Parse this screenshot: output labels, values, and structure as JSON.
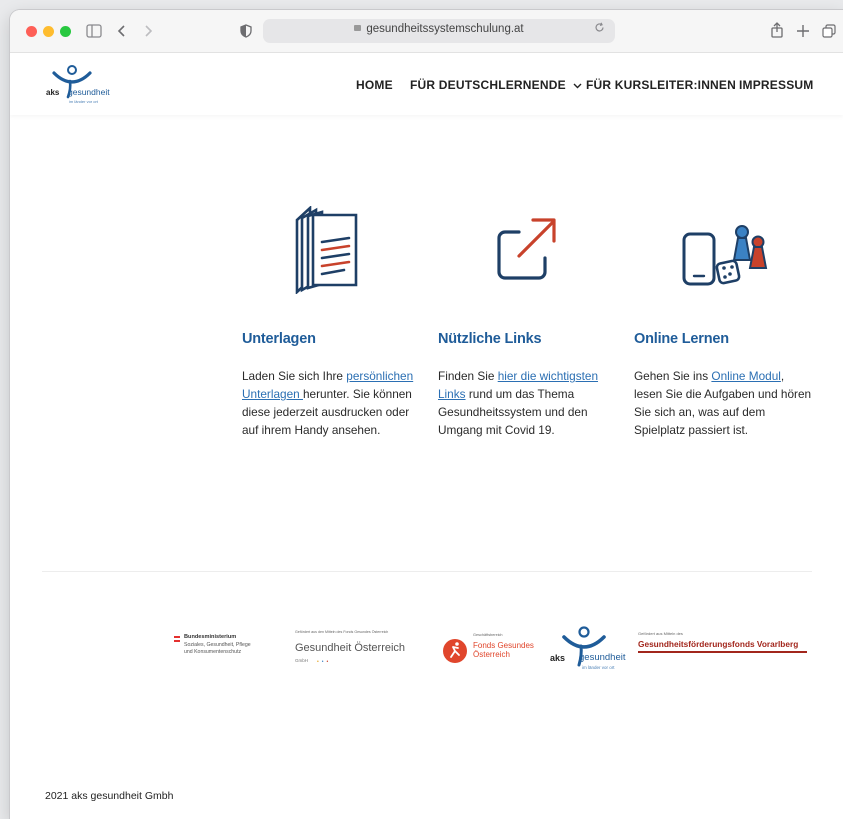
{
  "browser": {
    "url": "gesundheitssystemschulung.at",
    "colors": {
      "close": "#fe5f57",
      "minimize": "#febc2e",
      "maximize": "#28c840"
    },
    "icons": [
      "sidebar-icon",
      "back-icon",
      "forward-icon",
      "shield-icon",
      "reload-icon",
      "share-icon",
      "new-tab-icon",
      "tabs-overview-icon"
    ]
  },
  "header": {
    "logo": {
      "brand_left": "aks",
      "brand_right": "gesundheit",
      "tagline": "im länder vor ort"
    },
    "nav": [
      {
        "label": "HOME"
      },
      {
        "label": "FÜR DEUTSCHLERNENDE",
        "has_dropdown": true
      },
      {
        "label": "FÜR KURSLEITER:INNEN"
      },
      {
        "label": "IMPRESSUM"
      }
    ]
  },
  "cards": [
    {
      "icon": "documents-icon",
      "title": "Unterlagen",
      "text_before": "Laden Sie sich Ihre ",
      "link": "persönlichen Unterlagen ",
      "text_after": "herunter. Sie können diese jederzeit ausdrucken oder auf ihrem Handy ansehen."
    },
    {
      "icon": "external-link-icon",
      "title": "Nützliche Links",
      "text_before": "Finden Sie ",
      "link": "hier die wichtigsten Links",
      "text_after": " rund um das Thema Gesundheitssystem und den Umgang mit Covid 19."
    },
    {
      "icon": "phone-game-icon",
      "title": "Online Lernen",
      "text_before": "Gehen Sie ins ",
      "link": "Online Modul",
      "text_after": ", lesen Sie die Aufgaben und hören Sie sich an, was auf dem Spielplatz passiert ist."
    }
  ],
  "sponsors": {
    "ministry": {
      "line1": "Bundesministerium",
      "line2": "Soziales, Gesundheit, Pflege",
      "line3": "und Konsumentenschutz"
    },
    "goe": {
      "small": "Gefördert aus den Mitteln des Fonds Gesundes Österreich",
      "name": "Gesundheit Österreich",
      "sub": "GmbH"
    },
    "fgoe": {
      "small": "Geschäftsbereich",
      "line1": "Fonds Gesundes",
      "line2": "Österreich"
    },
    "aks": {
      "brand_left": "aks",
      "brand_right": "gesundheit",
      "tagline": "im länder vor ort"
    },
    "vorarlberg": {
      "small": "Gefördert aus Mitteln des",
      "name": "Gesundheitsförderungsfonds Vorarlberg"
    }
  },
  "footer": {
    "copyright": "2021 aks gesundheit Gmbh"
  },
  "colors": {
    "accent_blue": "#1f5c99",
    "accent_red": "#c8422b",
    "link": "#2b6fb3"
  }
}
